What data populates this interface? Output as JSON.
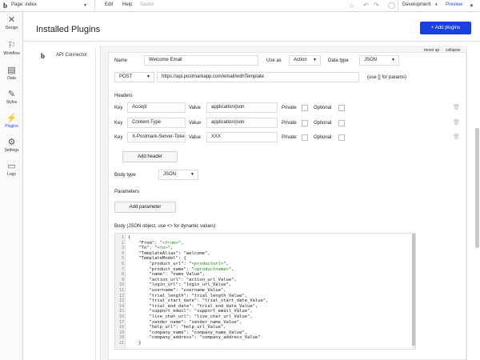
{
  "topbar": {
    "logo": "b",
    "page_selector": "Page: index",
    "menu": [
      "Edit",
      "Help",
      "Saved"
    ],
    "environment": "Development",
    "preview": "Preview"
  },
  "sidebar": {
    "items": [
      {
        "label": "Design",
        "icon": "design-icon"
      },
      {
        "label": "Workflow",
        "icon": "workflow-icon"
      },
      {
        "label": "Data",
        "icon": "data-icon"
      },
      {
        "label": "Styles",
        "icon": "styles-icon"
      },
      {
        "label": "Plugins",
        "icon": "plugins-icon",
        "active": true
      },
      {
        "label": "Settings",
        "icon": "settings-icon"
      },
      {
        "label": "Logs",
        "icon": "logs-icon"
      }
    ]
  },
  "main": {
    "title": "Installed Plugins",
    "add_button": "+ Add plugins"
  },
  "plugin_list": {
    "items": [
      {
        "logo": "b",
        "name": "API Connector"
      }
    ]
  },
  "panel": {
    "move_up": "move up",
    "collapse": "collapse"
  },
  "call": {
    "name_label": "Name",
    "name_value": "Welcome Email",
    "use_as_label": "Use as",
    "use_as_value": "Action",
    "data_type_label": "Data type",
    "data_type_value": "JSON",
    "method": "POST",
    "url": "https://api.postmarkapp.com/email/withTemplate",
    "url_hint": "(use [] for params)",
    "headers_label": "Headers",
    "headers": [
      {
        "key_label": "Key",
        "key": "Accept",
        "value_label": "Value",
        "value": "application/json",
        "private_label": "Private",
        "optional_label": "Optional"
      },
      {
        "key_label": "Key",
        "key": "Content-Type",
        "value_label": "Value",
        "value": "application/json",
        "private_label": "Private",
        "optional_label": "Optional"
      },
      {
        "key_label": "Key",
        "key": "X-Postmark-Server-Token",
        "value_label": "Value",
        "value": "XXX",
        "private_label": "Private",
        "optional_label": "Optional"
      }
    ],
    "add_header": "Add header",
    "body_type_label": "Body type",
    "body_type_value": "JSON",
    "parameters_label": "Parameters",
    "add_parameter": "Add parameter",
    "body_label": "Body (JSON object, use <> for dynamic values)"
  },
  "code": {
    "lines": [
      {
        "n": "1",
        "pre": "{",
        "hl": "",
        "post": ""
      },
      {
        "n": "2",
        "pre": "    \"From\": \"",
        "hl": "<from>",
        "post": "\","
      },
      {
        "n": "3",
        "pre": "    \"To\": \"",
        "hl": "<to>",
        "post": "\","
      },
      {
        "n": "4",
        "pre": "    \"TemplateAlias\": \"welcome\",",
        "hl": "",
        "post": ""
      },
      {
        "n": "5",
        "pre": "    \"TemplateModel\": {",
        "hl": "",
        "post": ""
      },
      {
        "n": "6",
        "pre": "        \"product_url\": \"",
        "hl": "<producturl>",
        "post": "\","
      },
      {
        "n": "7",
        "pre": "        \"product_name\": \"",
        "hl": "<productname>",
        "post": "\","
      },
      {
        "n": "8",
        "pre": "        \"name\": \"name_Value\",",
        "hl": "",
        "post": ""
      },
      {
        "n": "9",
        "pre": "        \"action_url\": \"action_url_Value\",",
        "hl": "",
        "post": ""
      },
      {
        "n": "10",
        "pre": "        \"login_url\": \"login_url_Value\",",
        "hl": "",
        "post": ""
      },
      {
        "n": "11",
        "pre": "        \"username\": \"username_Value\",",
        "hl": "",
        "post": ""
      },
      {
        "n": "12",
        "pre": "        \"trial_length\": \"trial_length_Value\",",
        "hl": "",
        "post": ""
      },
      {
        "n": "13",
        "pre": "        \"trial_start_date\": \"trial_start_date_Value\",",
        "hl": "",
        "post": ""
      },
      {
        "n": "14",
        "pre": "        \"trial_end_date\": \"trial_end_date_Value\",",
        "hl": "",
        "post": ""
      },
      {
        "n": "15",
        "pre": "        \"support_email\": \"support_email_Value\",",
        "hl": "",
        "post": ""
      },
      {
        "n": "16",
        "pre": "        \"live_chat_url\": \"live_chat_url_Value\",",
        "hl": "",
        "post": ""
      },
      {
        "n": "17",
        "pre": "        \"sender_name\": \"sender_name_Value\",",
        "hl": "",
        "post": ""
      },
      {
        "n": "18",
        "pre": "        \"help_url\": \"help_url_Value\",",
        "hl": "",
        "post": ""
      },
      {
        "n": "19",
        "pre": "        \"company_name\": \"company_name_Value\",",
        "hl": "",
        "post": ""
      },
      {
        "n": "20",
        "pre": "        \"company_address\": \"company_address_Value\"",
        "hl": "",
        "post": ""
      },
      {
        "n": "21",
        "pre": "    }",
        "hl": "",
        "post": ""
      }
    ]
  }
}
